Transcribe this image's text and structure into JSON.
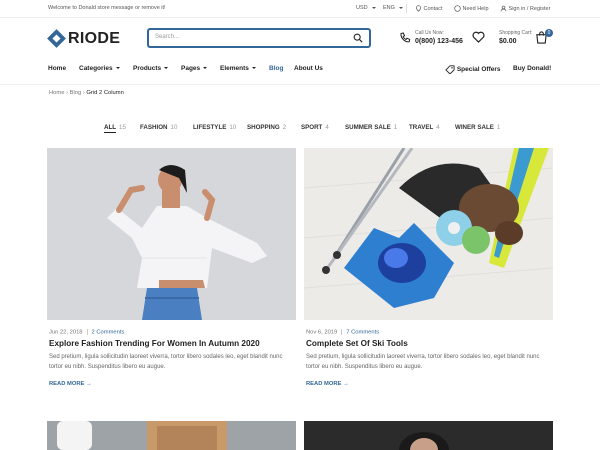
{
  "topbar": {
    "welcome": "Welcome to Donald store message or remove it!",
    "currency": "USD",
    "language": "ENG",
    "contact": "Contact",
    "help": "Need Help",
    "signin": "Sign in / Register"
  },
  "header": {
    "logo": "RIODE",
    "search_placeholder": "Search...",
    "call_label": "Call Us Now:",
    "call_number": "0(800) 123-456",
    "cart_label": "Shopping Cart:",
    "cart_total": "$0.00",
    "cart_count": "0"
  },
  "nav": {
    "items": [
      "Home",
      "Categories",
      "Products",
      "Pages",
      "Elements",
      "Blog",
      "About Us"
    ],
    "active": "Blog",
    "special_offers": "Special Offers",
    "buy": "Buy Donald!"
  },
  "breadcrumb": {
    "items": [
      "Home",
      "Blog",
      "Grid 2 Column"
    ]
  },
  "filters": [
    {
      "label": "ALL",
      "count": "15"
    },
    {
      "label": "FASHION",
      "count": "10"
    },
    {
      "label": "LIFESTYLE",
      "count": "10"
    },
    {
      "label": "SHOPPING",
      "count": "2"
    },
    {
      "label": "SPORT",
      "count": "4"
    },
    {
      "label": "SUMMER SALE",
      "count": "1"
    },
    {
      "label": "TRAVEL",
      "count": "4"
    },
    {
      "label": "WINER SALE",
      "count": "1"
    }
  ],
  "posts": [
    {
      "date": "Jun 22, 2018",
      "comments": "2 Comments",
      "title": "Explore Fashion Trending For Women In Autumn 2020",
      "excerpt": "Sed pretium, ligula sollicitudin laoreet viverra, tortor libero sodales leo, eget blandit nunc tortor eu nibh. Suspenditus libero eu augue.",
      "read_more": "READ MORE"
    },
    {
      "date": "Nov 6, 2019",
      "comments": "7 Comments",
      "title": "Complete Set Of Ski Tools",
      "excerpt": "Sed pretium, ligula sollicitudin laoreet viverra, tortor libero sodales leo, eget blandit nunc tortor eu nibh. Suspenditus libero eu augue.",
      "read_more": "READ MORE"
    }
  ],
  "colors": {
    "accent": "#336699"
  }
}
